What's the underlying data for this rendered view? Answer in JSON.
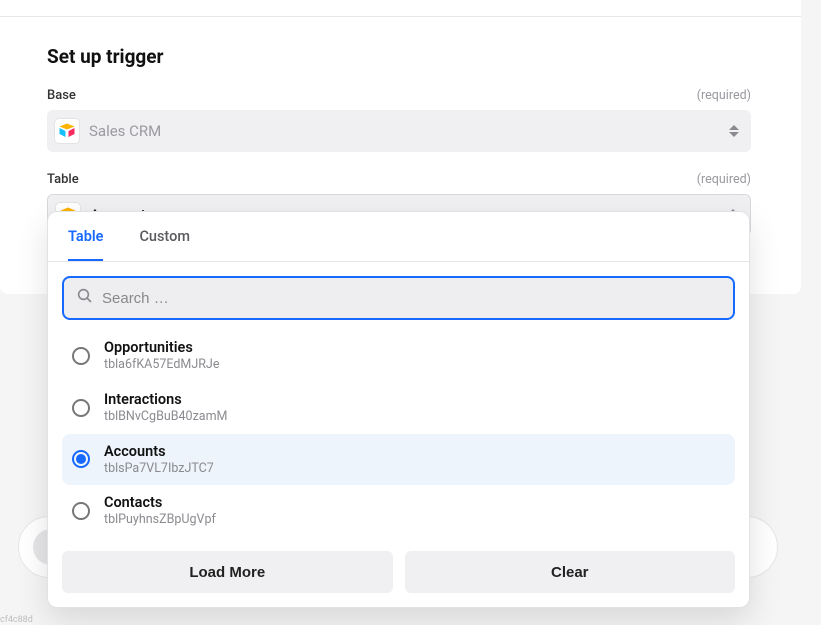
{
  "header": {
    "title": "Set up trigger"
  },
  "fields": {
    "base": {
      "label": "Base",
      "required_text": "(required)",
      "selected": "Sales CRM"
    },
    "table": {
      "label": "Table",
      "required_text": "(required)",
      "selected": "Accounts"
    }
  },
  "dropdown": {
    "tabs": {
      "table": "Table",
      "custom": "Custom"
    },
    "search_placeholder": "Search …",
    "options": [
      {
        "name": "Opportunities",
        "id": "tbla6fKA57EdMJRJe",
        "selected": false
      },
      {
        "name": "Interactions",
        "id": "tblBNvCgBuB40zamM",
        "selected": false
      },
      {
        "name": "Accounts",
        "id": "tblsPa7VL7IbzJTC7",
        "selected": true
      },
      {
        "name": "Contacts",
        "id": "tblPuyhnsZBpUgVpf",
        "selected": false
      }
    ],
    "buttons": {
      "load_more": "Load More",
      "clear": "Clear"
    }
  },
  "footer_hash": "cf4c88d"
}
